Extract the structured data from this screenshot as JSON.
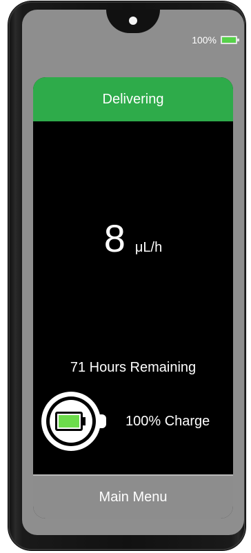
{
  "status_bar": {
    "battery_percent": "100%",
    "battery_icon": "battery-full-icon",
    "battery_color": "#57d14a"
  },
  "header": {
    "status": "Delivering",
    "color": "#2eab4a"
  },
  "rate": {
    "value": "8",
    "unit": "μL/h"
  },
  "time_remaining": "71 Hours Remaining",
  "charge": {
    "label": "100% Charge",
    "level": 1.0,
    "icon": "battery-gauge-icon",
    "fill_color": "#6cdc4b"
  },
  "menu": {
    "label": "Main Menu"
  }
}
